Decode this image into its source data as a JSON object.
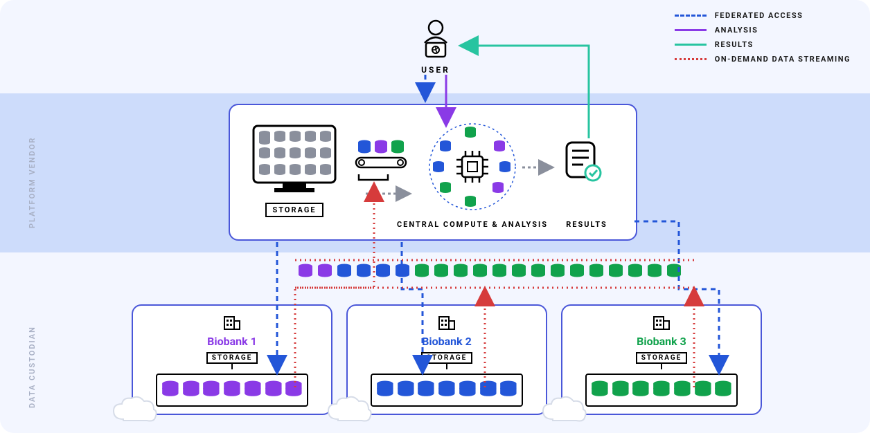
{
  "user_label": "USER",
  "legend": {
    "federated": "FEDERATED ACCESS",
    "analysis": "ANALYSIS",
    "results": "RESULTS",
    "streaming": "ON-DEMAND DATA STREAMING"
  },
  "side_labels": {
    "vendor": "PLATFORM VENDOR",
    "custodian": "DATA CUSTODIAN"
  },
  "platform": {
    "storage_label": "STORAGE",
    "compute_label": "CENTRAL COMPUTE & ANALYSIS",
    "results_label": "RESULTS"
  },
  "biobanks": {
    "b1": {
      "title": "Biobank 1",
      "storage": "STORAGE"
    },
    "b2": {
      "title": "Biobank 2",
      "storage": "STORAGE"
    },
    "b3": {
      "title": "Biobank 3",
      "storage": "STORAGE"
    }
  },
  "colors": {
    "blue": "#2356d8",
    "purple": "#8a3ae6",
    "green": "#11a24c",
    "teal": "#27c4a0",
    "red": "#d63b3b",
    "panel_border": "#4a57d9"
  }
}
